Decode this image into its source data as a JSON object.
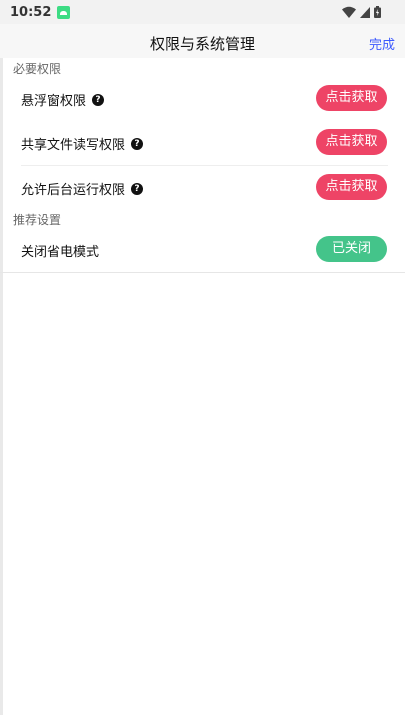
{
  "status": {
    "time": "10:52"
  },
  "header": {
    "title": "权限与系统管理",
    "done_label": "完成"
  },
  "sections": {
    "required": {
      "title": "必要权限",
      "items": [
        {
          "label": "悬浮窗权限",
          "button": "点击获取"
        },
        {
          "label": "共享文件读写权限",
          "button": "点击获取"
        },
        {
          "label": "允许后台运行权限",
          "button": "点击获取"
        }
      ]
    },
    "recommended": {
      "title": "推荐设置",
      "items": [
        {
          "label": "关闭省电模式",
          "button": "已关闭"
        }
      ]
    }
  },
  "colors": {
    "accent_red": "#ee4466",
    "accent_green": "#44c48a",
    "link_blue": "#3d5afe"
  },
  "icons": [
    "android-icon",
    "wifi-icon",
    "signal-icon",
    "battery-icon",
    "help-icon"
  ]
}
